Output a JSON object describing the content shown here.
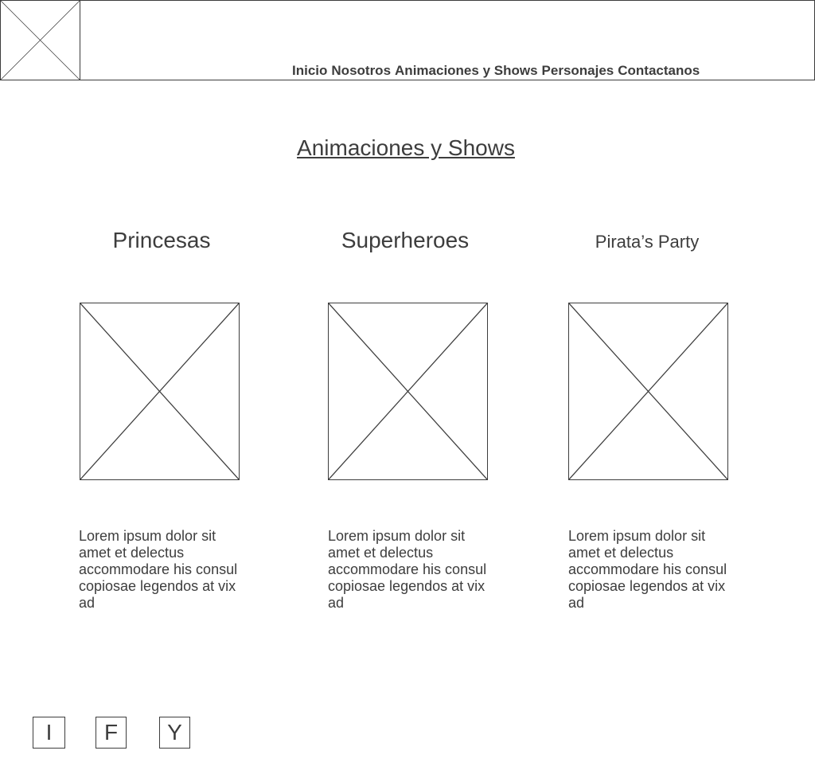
{
  "header": {
    "logo": "image-placeholder-icon",
    "nav": [
      "Inicio",
      "Nosotros",
      "Animaciones y Shows",
      "Personajes",
      "Contactanos"
    ]
  },
  "main": {
    "title": "Animaciones y Shows",
    "cards": [
      {
        "title": "Princesas",
        "image": "image-placeholder-icon",
        "text": "Lorem ipsum dolor sit amet et delectus accommodare his consul copiosae legendos at vix ad"
      },
      {
        "title": "Superheroes",
        "image": "image-placeholder-icon",
        "text": "Lorem ipsum dolor sit amet et delectus accommodare his consul copiosae legendos at vix ad"
      },
      {
        "title": "Pirata’s Party",
        "image": "image-placeholder-icon",
        "text": "Lorem ipsum dolor sit amet et delectus accommodare his consul copiosae legendos at vix ad"
      }
    ]
  },
  "footer": {
    "social": [
      "I",
      "F",
      "Y"
    ]
  }
}
